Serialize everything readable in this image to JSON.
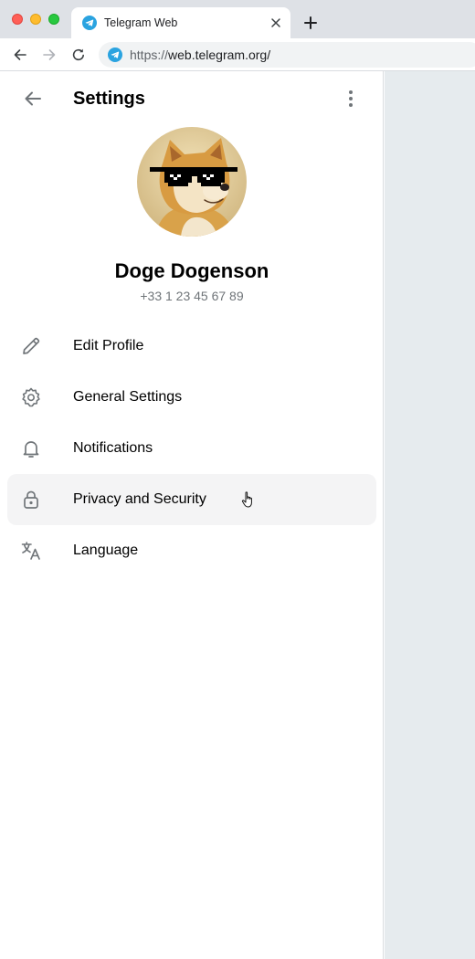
{
  "browser": {
    "tab_title": "Telegram Web",
    "url_scheme": "https://",
    "url_host": "web.telegram.org/",
    "favicon": "telegram-icon",
    "accent": "#2aa3e0"
  },
  "settings": {
    "title": "Settings",
    "back_icon": "arrow-left-icon",
    "more_icon": "more-vertical-icon"
  },
  "profile": {
    "name": "Doge Dogenson",
    "phone": "+33 1 23 45 67 89",
    "avatar": "doge-with-sunglasses"
  },
  "menu": {
    "items": [
      {
        "label": "Edit Profile",
        "icon": "pencil-icon"
      },
      {
        "label": "General Settings",
        "icon": "gear-icon"
      },
      {
        "label": "Notifications",
        "icon": "bell-icon"
      },
      {
        "label": "Privacy and Security",
        "icon": "lock-icon",
        "hovered": true
      },
      {
        "label": "Language",
        "icon": "translate-icon"
      }
    ]
  },
  "colors": {
    "hover_bg": "#f4f4f5",
    "secondary_text": "#707579",
    "right_pane_bg": "#e6ebee"
  }
}
